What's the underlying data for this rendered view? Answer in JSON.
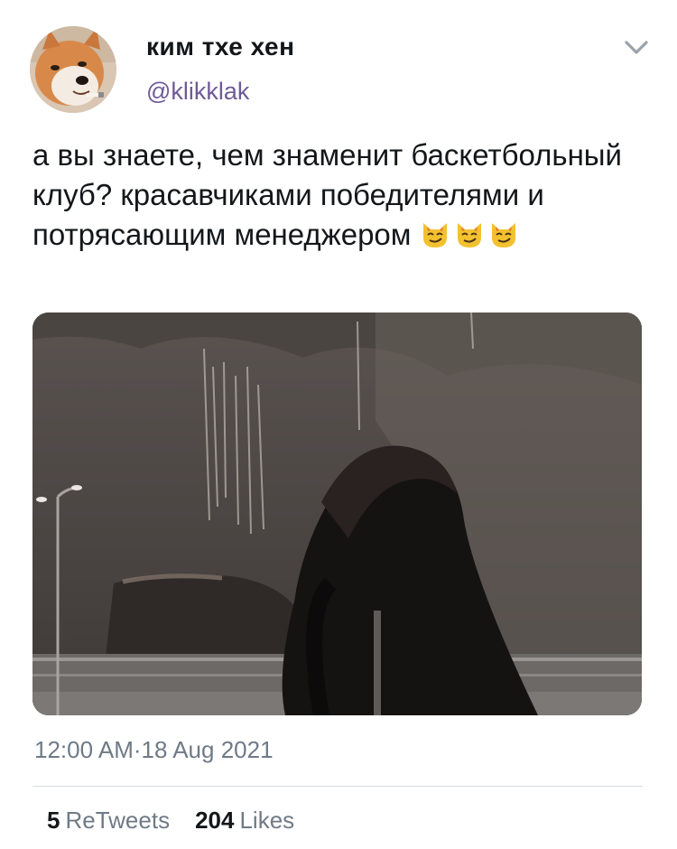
{
  "tweet": {
    "display_name": "ким тхе хен",
    "handle": "@klikklak",
    "text": "а вы знаете, чем знаменит баскетбольный клуб? красавчиками победителями и потрясающим менеджером",
    "emojis": [
      "smirking-cat-face-emoji",
      "smirking-cat-face-emoji",
      "smirking-cat-face-emoji"
    ],
    "timestamp": "12:00 AM·18 Aug 2021",
    "retweets_count": "5",
    "retweets_label": "ReTweets",
    "likes_count": "204",
    "likes_label": "Likes"
  },
  "icons": {
    "menu": "chevron-down-icon",
    "avatar": "shiba-inu-avatar"
  },
  "colors": {
    "text": "#14171a",
    "handle": "#6f5b96",
    "meta": "#6f7a86",
    "divider": "#d7dbdf"
  }
}
